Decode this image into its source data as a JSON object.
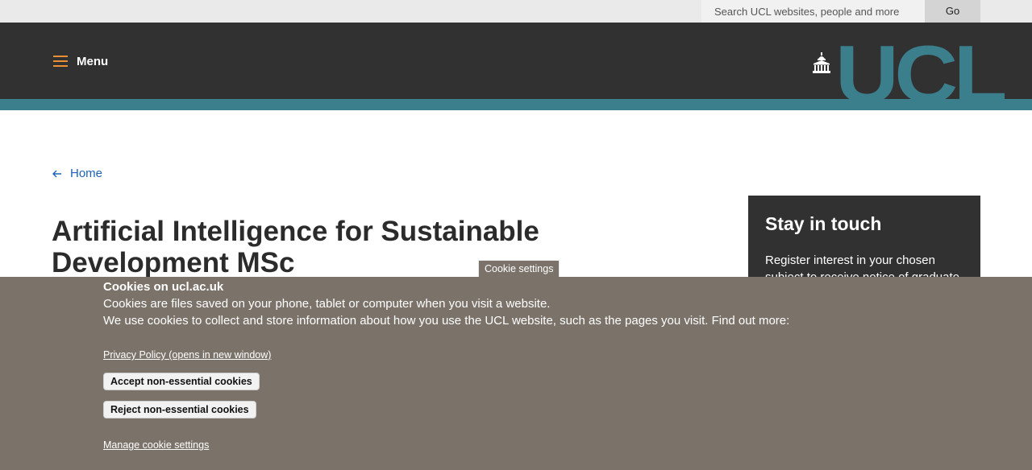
{
  "search": {
    "placeholder": "Search UCL websites, people and more",
    "go_label": "Go"
  },
  "header": {
    "menu_label": "Menu",
    "logo_text": "UCL"
  },
  "breadcrumb": {
    "home_label": "Home"
  },
  "page": {
    "title": "Artificial Intelligence for Sustainable Development MSc"
  },
  "sidebar": {
    "title": "Stay in touch",
    "text": "Register interest in your chosen subject to receive notice of graduate"
  },
  "cookie": {
    "tab_label": "Cookie settings",
    "heading": "Cookies on ucl.ac.uk",
    "line1": "Cookies are files saved on your phone, tablet or computer when you visit a website.",
    "line2": "We use cookies to collect and store information about how you use the UCL website, such as the pages you visit. Find out more:",
    "privacy_link": "Privacy Policy (opens in new window)",
    "accept_label": "Accept non-essential cookies",
    "reject_label": "Reject non-essential cookies",
    "manage_label": "Manage cookie settings"
  },
  "colors": {
    "brand_teal": "#3b7f8d",
    "header_dark": "#313131",
    "accent_orange": "#e98f36",
    "cookie_bg": "#7b726a",
    "link_blue": "#1e63b4"
  },
  "icons": {
    "menu": "hamburger-icon",
    "logo": "portico-icon",
    "back": "arrow-left-icon"
  }
}
